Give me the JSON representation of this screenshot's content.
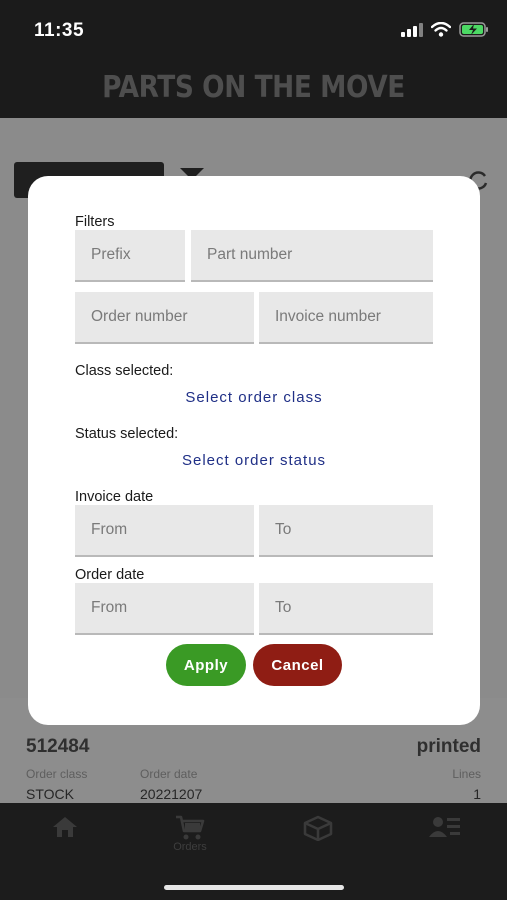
{
  "status_bar": {
    "time": "11:35",
    "icons": [
      "signal-icon",
      "wifi-icon",
      "battery-charging-icon"
    ]
  },
  "header": {
    "title": "PARTS ON THE MOVE"
  },
  "modal": {
    "filters_label": "Filters",
    "prefix_placeholder": "Prefix",
    "part_number_placeholder": "Part number",
    "order_number_placeholder": "Order number",
    "invoice_number_placeholder": "Invoice number",
    "class_label": "Class selected:",
    "class_link": "Select order class",
    "status_label": "Status selected:",
    "status_link": "Select order status",
    "invoice_date_label": "Invoice date",
    "invoice_from_placeholder": "From",
    "invoice_to_placeholder": "To",
    "order_date_label": "Order date",
    "order_from_placeholder": "From",
    "order_to_placeholder": "To",
    "apply_label": "Apply",
    "cancel_label": "Cancel",
    "apply_color": "#3a9a25",
    "cancel_color": "#8f1d14",
    "link_color": "#1f2f86"
  },
  "background_order": {
    "order_number": "512484",
    "status": "printed",
    "order_class_label": "Order class",
    "order_class_value": "STOCK",
    "order_date_label": "Order date",
    "order_date_value": "20221207",
    "lines_label": "Lines",
    "lines_value": "1"
  },
  "tab_bar": {
    "tabs": [
      {
        "icon": "home-icon",
        "label": ""
      },
      {
        "icon": "cart-icon",
        "label": "Orders"
      },
      {
        "icon": "box-icon",
        "label": ""
      },
      {
        "icon": "user-list-icon",
        "label": ""
      }
    ]
  }
}
